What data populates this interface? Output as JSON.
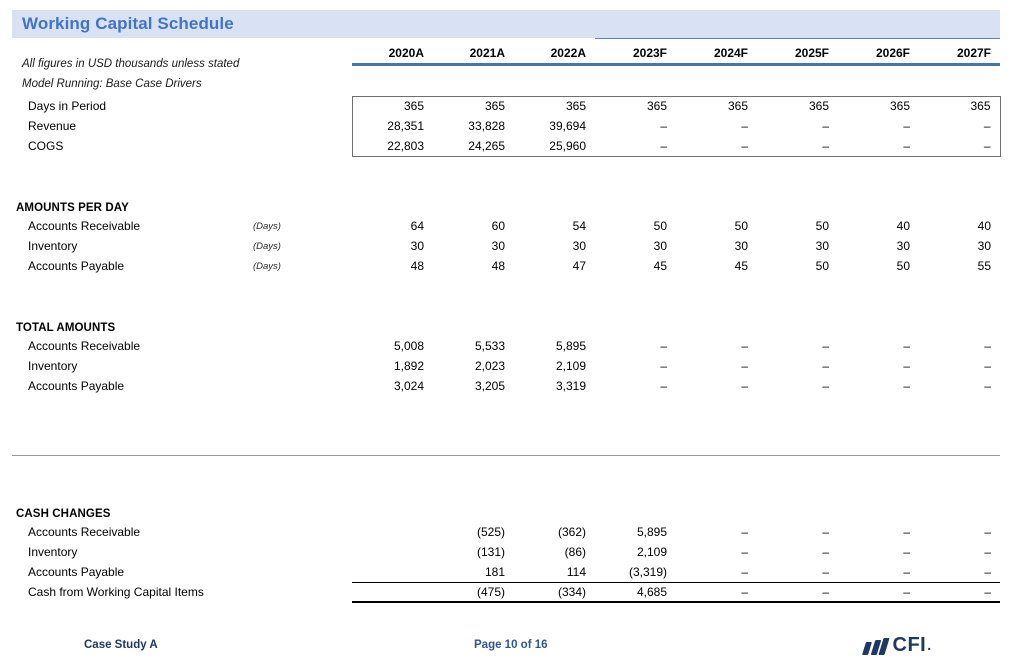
{
  "title": "Working Capital Schedule",
  "notes": {
    "units": "All figures in USD thousands unless stated",
    "scenario": "Model Running: Base Case Drivers"
  },
  "colors": {
    "title_band": "#d9e2f3",
    "title_text": "#4273c8",
    "header_rule": "#4774ab",
    "forecast_rule": "#5b84b8",
    "footer_text": "#2f5597",
    "logo": "#1f3864"
  },
  "columns": {
    "label_header": "",
    "unit_header": "",
    "years": [
      "2020A",
      "2021A",
      "2022A",
      "2023F",
      "2024F",
      "2025F",
      "2026F",
      "2027F"
    ],
    "actual_count": 3,
    "forecast_count": 5
  },
  "inputs": {
    "rows": [
      {
        "label": "Days in Period",
        "unit": "",
        "values": [
          "365",
          "365",
          "365",
          "365",
          "365",
          "365",
          "365",
          "365"
        ]
      },
      {
        "label": "Revenue",
        "unit": "",
        "values": [
          "28,351",
          "33,828",
          "39,694",
          "–",
          "–",
          "–",
          "–",
          "–"
        ]
      },
      {
        "label": "COGS",
        "unit": "",
        "values": [
          "22,803",
          "24,265",
          "25,960",
          "–",
          "–",
          "–",
          "–",
          "–"
        ]
      }
    ]
  },
  "amounts_per_day": {
    "heading": "AMOUNTS PER DAY",
    "rows": [
      {
        "label": "Accounts Receivable",
        "unit": "(Days)",
        "values": [
          "64",
          "60",
          "54",
          "50",
          "50",
          "50",
          "40",
          "40"
        ]
      },
      {
        "label": "Inventory",
        "unit": "(Days)",
        "values": [
          "30",
          "30",
          "30",
          "30",
          "30",
          "30",
          "30",
          "30"
        ]
      },
      {
        "label": "Accounts Payable",
        "unit": "(Days)",
        "values": [
          "48",
          "48",
          "47",
          "45",
          "45",
          "50",
          "50",
          "55"
        ]
      }
    ]
  },
  "total_amounts": {
    "heading": "TOTAL AMOUNTS",
    "rows": [
      {
        "label": "Accounts Receivable",
        "unit": "",
        "values": [
          "5,008",
          "5,533",
          "5,895",
          "–",
          "–",
          "–",
          "–",
          "–"
        ]
      },
      {
        "label": "Inventory",
        "unit": "",
        "values": [
          "1,892",
          "2,023",
          "2,109",
          "–",
          "–",
          "–",
          "–",
          "–"
        ]
      },
      {
        "label": "Accounts Payable",
        "unit": "",
        "values": [
          "3,024",
          "3,205",
          "3,319",
          "–",
          "–",
          "–",
          "–",
          "–"
        ]
      }
    ]
  },
  "cash_changes": {
    "heading": "CASH CHANGES",
    "rows": [
      {
        "label": "Accounts Receivable",
        "unit": "",
        "values": [
          "",
          "(525)",
          "(362)",
          "5,895",
          "–",
          "–",
          "–",
          "–"
        ]
      },
      {
        "label": "Inventory",
        "unit": "",
        "values": [
          "",
          "(131)",
          "(86)",
          "2,109",
          "–",
          "–",
          "–",
          "–"
        ]
      },
      {
        "label": "Accounts Payable",
        "unit": "",
        "values": [
          "",
          "181",
          "114",
          "(3,319)",
          "–",
          "–",
          "–",
          "–"
        ]
      }
    ],
    "total": {
      "label": "Cash from Working Capital Items",
      "unit": "",
      "values": [
        "",
        "(475)",
        "(334)",
        "4,685",
        "–",
        "–",
        "–",
        "–"
      ]
    }
  },
  "footer": {
    "left": "Case Study A",
    "center": "Page 10 of 16",
    "logo_text": "CFI",
    "logo_dot": "."
  }
}
